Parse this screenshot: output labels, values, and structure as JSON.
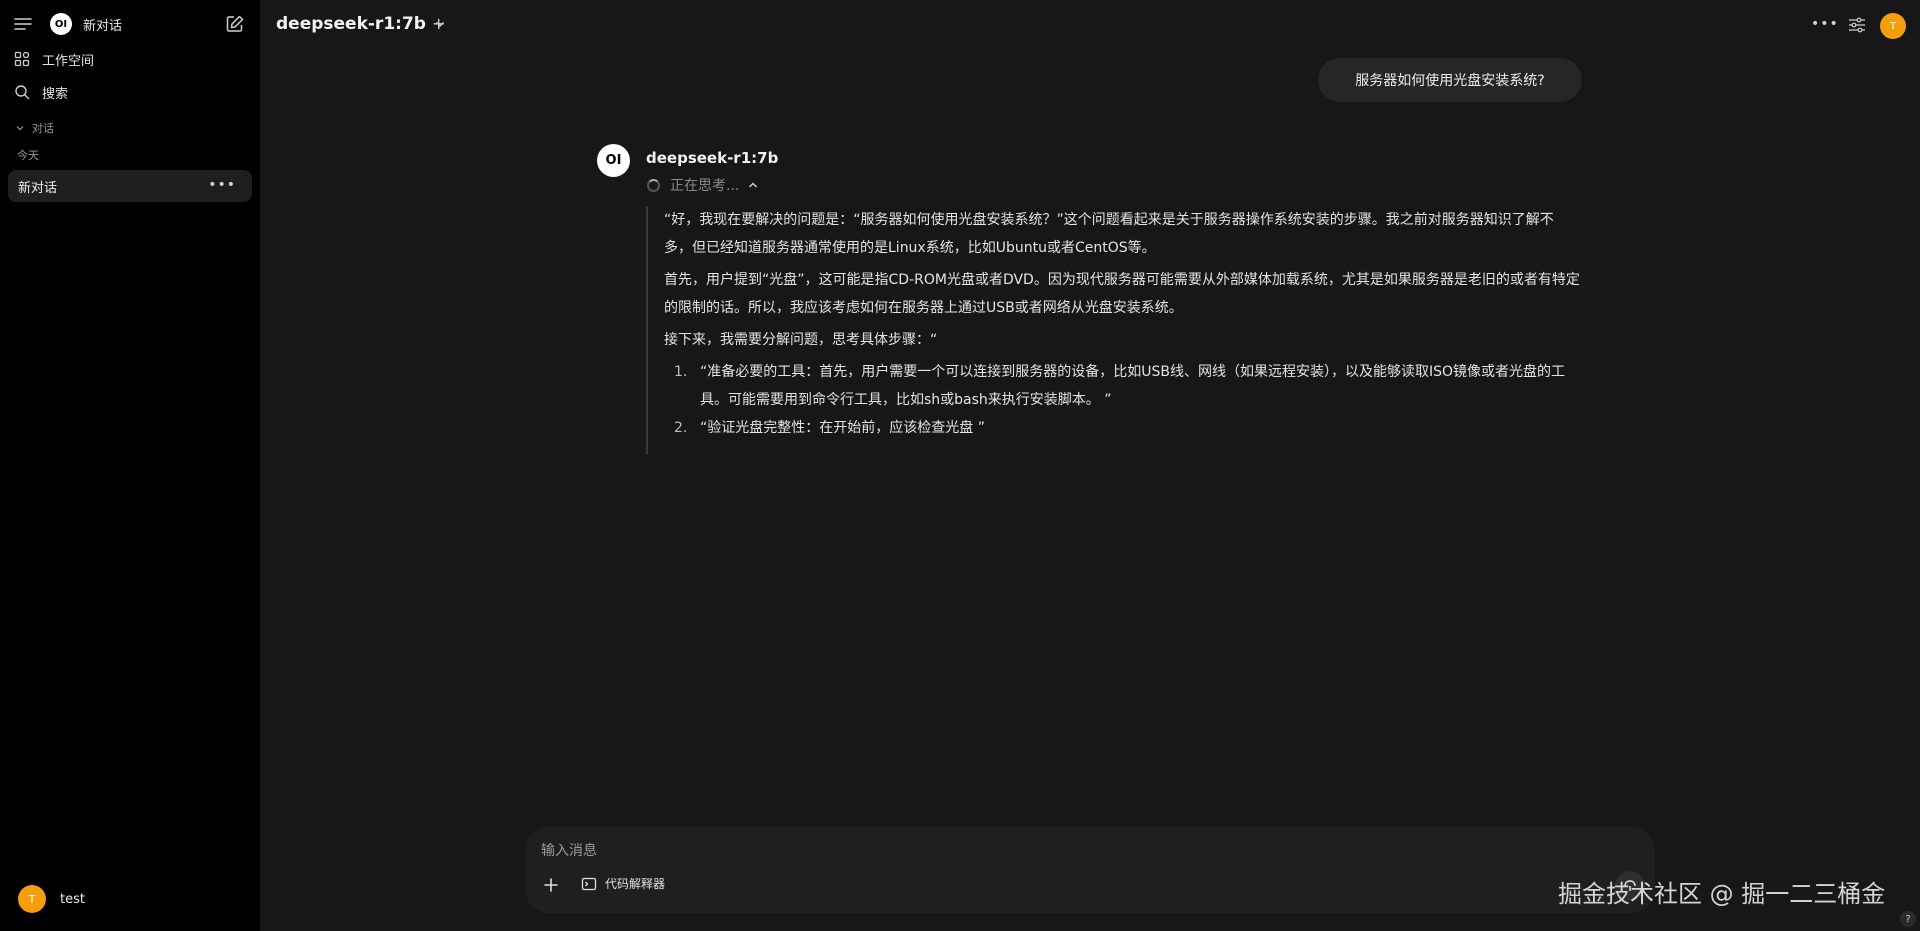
{
  "sidebar": {
    "title": "新对话",
    "logo_text": "OI",
    "workspace_label": "工作空间",
    "search_label": "搜索",
    "section_label": "对话",
    "today_label": "今天",
    "chat_items": [
      {
        "label": "新对话"
      }
    ],
    "user": {
      "avatar_initial": "T",
      "name": "test"
    }
  },
  "header": {
    "model_name": "deepseek-r1:7b",
    "add_label": "+",
    "avatar_initial": "T"
  },
  "conversation": {
    "user_message": "服务器如何使用光盘安装系统?",
    "assistant": {
      "logo_text": "OI",
      "model_name": "deepseek-r1:7b",
      "thinking_status": "正在思考...",
      "paragraphs": [
        "“好，我现在要解决的问题是：“服务器如何使用光盘安装系统？”这个问题看起来是关于服务器操作系统安装的步骤。我之前对服务器知识了解不多，但已经知道服务器通常使用的是Linux系统，比如Ubuntu或者CentOS等。",
        "首先，用户提到“光盘”，这可能是指CD-ROM光盘或者DVD。因为现代服务器可能需要从外部媒体加载系统，尤其是如果服务器是老旧的或者有特定的限制的话。所以，我应该考虑如何在服务器上通过USB或者网络从光盘安装系统。",
        "接下来，我需要分解问题，思考具体步骤：“"
      ],
      "list_items": [
        {
          "num": "1.",
          "text": "“准备必要的工具：首先，用户需要一个可以连接到服务器的设备，比如USB线、网线（如果远程安装），以及能够读取ISO镜像或者光盘的工具。可能需要用到命令行工具，比如sh或bash来执行安装脚本。 ”"
        },
        {
          "num": "2.",
          "text": "“验证光盘完整性：在开始前，应该检查光盘 ”"
        }
      ]
    }
  },
  "composer": {
    "placeholder": "输入消息",
    "code_interpreter_label": "代码解释器"
  },
  "watermark": "掘金技术社区 @ 掘一二三桶金",
  "help_label": "?",
  "colors": {
    "background": "#171717",
    "sidebar": "#000000",
    "bubble": "#262626",
    "avatar": "#f59e0b"
  }
}
